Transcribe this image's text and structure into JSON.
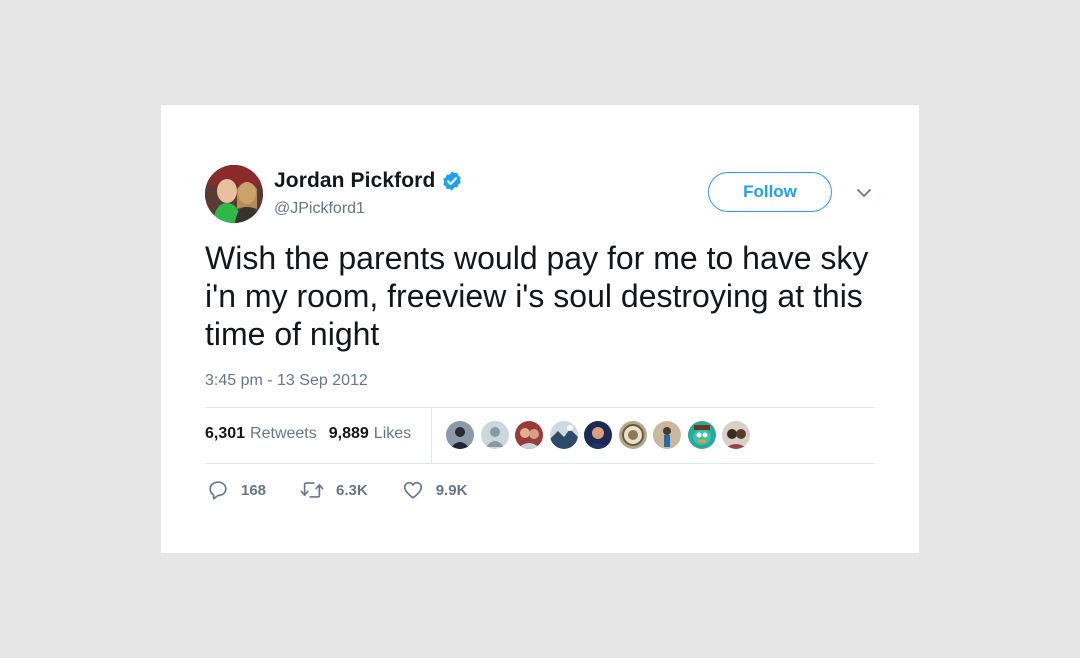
{
  "tweet": {
    "author": {
      "name": "Jordan Pickford",
      "handle": "@JPickford1",
      "verified": true
    },
    "follow_label": "Follow",
    "text": "Wish the parents would pay for me to have sky i'n my room, freeview i's soul destroying at this time of night",
    "timestamp": "3:45 pm - 13 Sep 2012",
    "stats": {
      "retweets_count": "6,301",
      "retweets_label": "Retweets",
      "likes_count": "9,889",
      "likes_label": "Likes"
    },
    "actions": {
      "replies": "168",
      "retweets": "6.3K",
      "likes": "9.9K"
    }
  },
  "colors": {
    "accent": "#1da1f2",
    "secondary_text": "#657786",
    "divider": "#e1e8ed",
    "background": "#e6e6e6"
  },
  "icons": [
    "verified-badge-icon",
    "chevron-down-icon",
    "reply-icon",
    "retweet-icon",
    "like-icon"
  ]
}
